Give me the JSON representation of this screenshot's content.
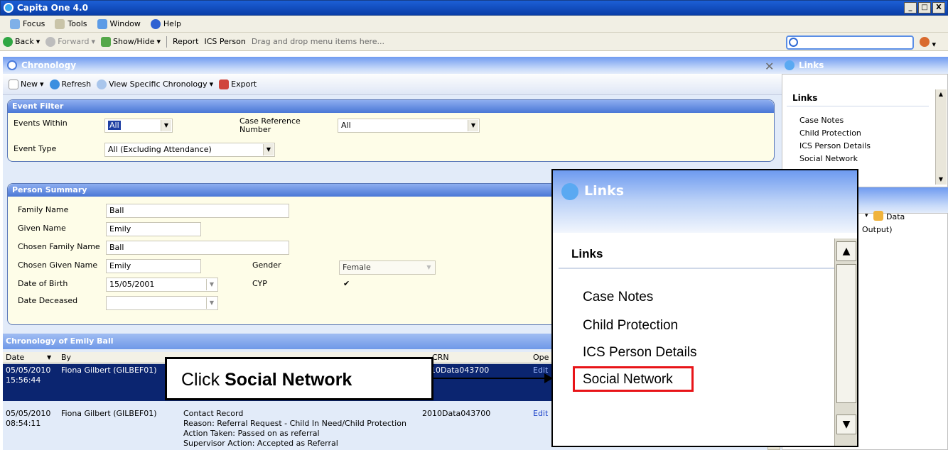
{
  "window": {
    "title": "Capita One 4.0",
    "min": "_",
    "max": "□",
    "close": "X"
  },
  "menu": {
    "focus": "Focus",
    "tools": "Tools",
    "window": "Window",
    "help": "Help"
  },
  "nav": {
    "back": "Back",
    "forward": "Forward",
    "showhide": "Show/Hide",
    "report": "Report",
    "ics_person": "ICS Person",
    "hint": "Drag and drop menu items here..."
  },
  "chronology": {
    "title": "Chronology",
    "toolbar": {
      "new": "New",
      "refresh": "Refresh",
      "view_specific": "View Specific Chronology",
      "export": "Export"
    }
  },
  "event_filter": {
    "title": "Event Filter",
    "events_within_label": "Events Within",
    "events_within_value": "All",
    "case_ref_label": "Case Reference",
    "case_ref_label2": "Number",
    "case_ref_value": "All",
    "event_type_label": "Event Type",
    "event_type_value": "All (Excluding Attendance)"
  },
  "person_summary": {
    "title": "Person Summary",
    "family_name_label": "Family Name",
    "family_name": "Ball",
    "given_name_label": "Given Name",
    "given_name": "Emily",
    "chosen_family_label": "Chosen Family Name",
    "chosen_family": "Ball",
    "chosen_given_label": "Chosen Given Name",
    "chosen_given": "Emily",
    "gender_label": "Gender",
    "gender": "Female",
    "dob_label": "Date of Birth",
    "dob": "15/05/2001",
    "cyp_label": "CYP",
    "cyp": "✔",
    "deceased_label": "Date Deceased"
  },
  "grid": {
    "title": "Chronology of Emily Ball",
    "col_date": "Date",
    "col_by": "By",
    "col_crn": "CRN",
    "col_ope": "Ope",
    "rows": [
      {
        "date": "05/05/2010",
        "time": "15:56:44",
        "by": "Fiona Gilbert (GILBEF01)",
        "crn": "2010Data043700",
        "crn_visible": "10Data043700",
        "edit": "Edit"
      },
      {
        "date": "05/05/2010",
        "time": "08:54:11",
        "by": "Fiona Gilbert (GILBEF01)",
        "desc1": "Contact Record",
        "desc2": "Reason: Referral Request - Child In Need/Child Protection",
        "desc3": "Action Taken: Passed on as referral",
        "desc4": "Supervisor Action: Accepted as Referral",
        "crn": "2010Data043700",
        "edit": "Edit"
      }
    ]
  },
  "links_panel": {
    "header": "Links",
    "title": "Links",
    "items": [
      "Case Notes",
      "Child Protection",
      "ICS Person Details",
      "Social Network"
    ]
  },
  "side2": {
    "data_label": "Data",
    "output_text": "Output)"
  },
  "zoom": {
    "header": "Links",
    "title": "Links",
    "items": [
      "Case Notes",
      "Child Protection",
      "ICS Person Details",
      "Social Network"
    ]
  },
  "callout": {
    "prefix": "Click",
    "target": "Social Network"
  }
}
